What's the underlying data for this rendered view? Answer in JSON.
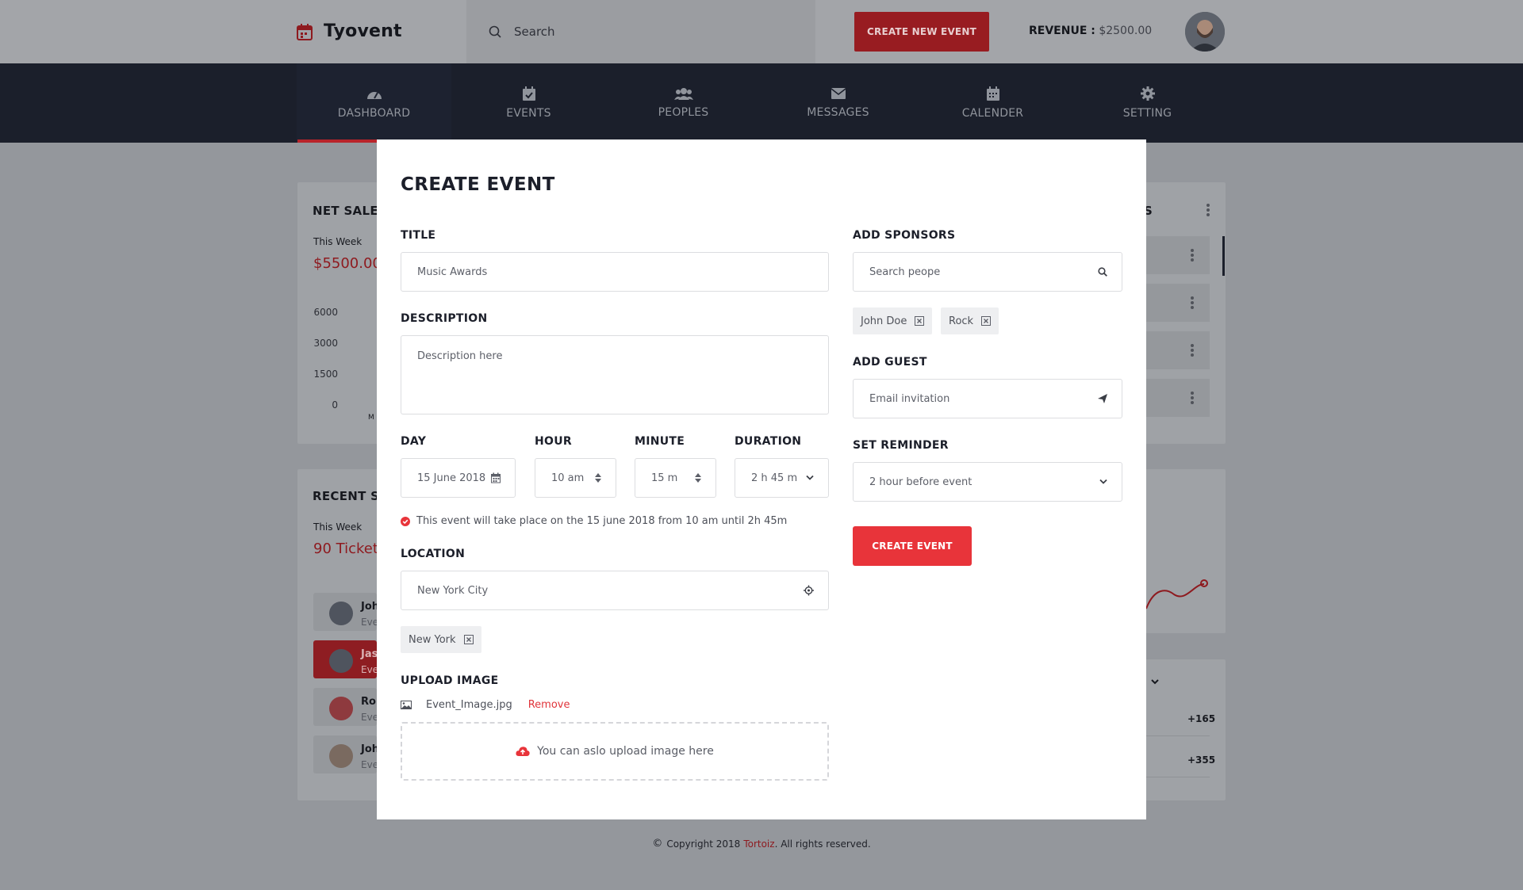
{
  "header": {
    "app_name": "Tyovent",
    "search_placeholder": "Search",
    "create_button": "CREATE NEW EVENT",
    "revenue_label": "REVENUE :",
    "revenue_value": "$2500.00"
  },
  "nav": {
    "items": [
      {
        "label": "DASHBOARD",
        "icon": "gauge-icon",
        "active": true
      },
      {
        "label": "EVENTS",
        "icon": "calendar-check-icon"
      },
      {
        "label": "PEOPLES",
        "icon": "users-icon"
      },
      {
        "label": "MESSAGES",
        "icon": "envelope-icon"
      },
      {
        "label": "CALENDER",
        "icon": "calendar-icon"
      },
      {
        "label": "SETTING",
        "icon": "gear-icon"
      }
    ]
  },
  "background": {
    "net_sales": {
      "title": "NET SALES",
      "period": "This Week",
      "value": "$5500.00",
      "axis": [
        "6000",
        "3000",
        "1500",
        "0"
      ],
      "x_first": "M"
    },
    "recent_sales": {
      "title": "RECENT S",
      "period": "This Week",
      "value": "90 Ticket",
      "rows": [
        {
          "name": "Joh",
          "sub": "Eve"
        },
        {
          "name": "Jas",
          "sub": "Eve"
        },
        {
          "name": "Ro",
          "sub": "Eve"
        },
        {
          "name": "Joh",
          "sub": "Eve"
        }
      ]
    },
    "right_card_title": "S",
    "stats": [
      "+165",
      "+355"
    ]
  },
  "modal": {
    "title": "CREATE EVENT",
    "title_label": "TITLE",
    "title_value": "Music Awards",
    "description_label": "DESCRIPTION",
    "description_placeholder": "Description here",
    "day_label": "DAY",
    "day_value": "15 June 2018",
    "hour_label": "HOUR",
    "hour_value": "10 am",
    "minute_label": "MINUTE",
    "minute_value": "15 m",
    "duration_label": "DURATION",
    "duration_value": "2 h 45 m",
    "note": "This event will take place on the 15 june 2018 from 10 am until 2h 45m",
    "location_label": "LOCATION",
    "location_value": "New York City",
    "location_chip": "New York",
    "upload_label": "UPLOAD IMAGE",
    "file_name": "Event_Image.jpg",
    "remove_label": "Remove",
    "dropzone_text": "You can aslo upload image here",
    "sponsors_label": "ADD SPONSORS",
    "sponsors_placeholder": "Search peope",
    "sponsor_chips": [
      "John Doe",
      "Rock"
    ],
    "guest_label": "ADD GUEST",
    "guest_placeholder": "Email invitation",
    "reminder_label": "SET REMINDER",
    "reminder_value": "2 hour before event",
    "create_button": "CREATE EVENT"
  },
  "footer": {
    "copyright_symbol": "©",
    "text_before": "Copyright 2018",
    "brand": "Tortoiz",
    "text_after": ". All rights reserved."
  },
  "colors": {
    "accent": "#e8343a",
    "nav_bg": "#1b1f2b",
    "overlay_bg": "#94979c"
  }
}
